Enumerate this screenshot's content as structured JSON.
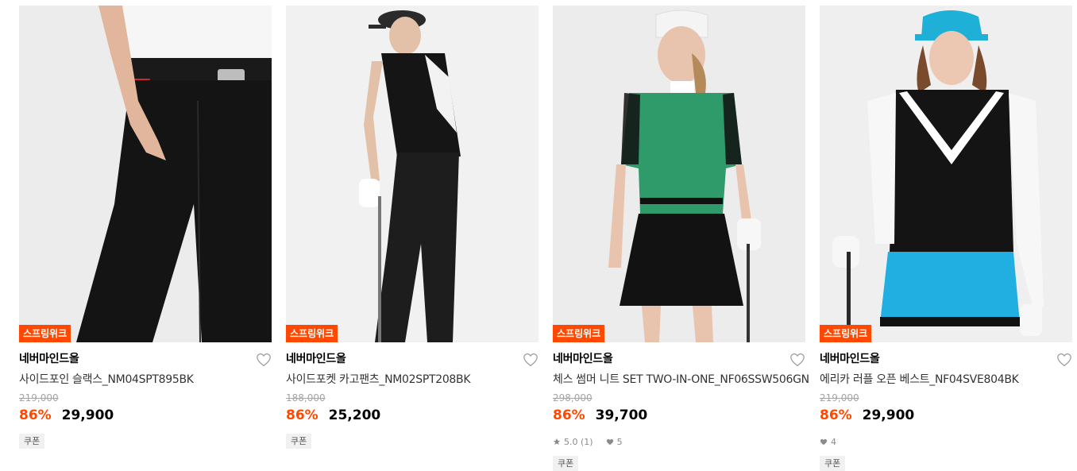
{
  "colors": {
    "accent": "#ff4800",
    "tag_bg": "#ff4800",
    "tag_text": "#ffffff"
  },
  "products": [
    {
      "tag": "스프링위크",
      "brand": "네버마인드올",
      "name": "사이드포인 슬랙스_NM04SPT895BK",
      "original_price": "219,000",
      "discount_rate": "86%",
      "price": "29,900",
      "rating": "",
      "likes": "",
      "coupon": "쿠폰",
      "image": "black-golf-pants-photo"
    },
    {
      "tag": "스프링위크",
      "brand": "네버마인드올",
      "name": "사이드포켓 카고팬츠_NM02SPT208BK",
      "original_price": "188,000",
      "discount_rate": "86%",
      "price": "25,200",
      "rating": "",
      "likes": "",
      "coupon": "쿠폰",
      "image": "man-golf-outfit-photo"
    },
    {
      "tag": "스프링위크",
      "brand": "네버마인드올",
      "name": "체스 썸머 니트 SET TWO-IN-ONE_NF06SSW506GN",
      "original_price": "298,000",
      "discount_rate": "86%",
      "price": "39,700",
      "rating": "5.0 (1)",
      "likes": "5",
      "coupon": "쿠폰",
      "image": "woman-green-knit-set-photo"
    },
    {
      "tag": "스프링위크",
      "brand": "네버마인드올",
      "name": "에리카 러플 오픈 베스트_NF04SVE804BK",
      "original_price": "219,000",
      "discount_rate": "86%",
      "price": "29,900",
      "rating": "",
      "likes": "4",
      "coupon": "쿠폰",
      "image": "woman-ruffle-vest-photo"
    }
  ]
}
